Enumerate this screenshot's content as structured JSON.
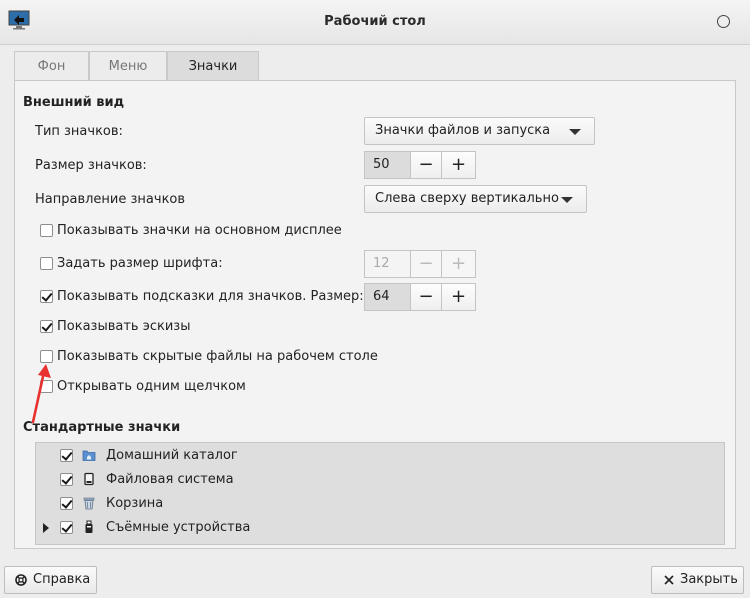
{
  "window": {
    "title": "Рабочий стол"
  },
  "tabs": [
    {
      "label": "Фон"
    },
    {
      "label": "Меню"
    },
    {
      "label": "Значки"
    }
  ],
  "appearance": {
    "title": "Внешний вид",
    "icon_type": {
      "label": "Тип значков:",
      "value": "Значки файлов и запуска"
    },
    "icon_size": {
      "label": "Размер значков:",
      "value": "50",
      "minus": "−",
      "plus": "+"
    },
    "icon_direction": {
      "label": "Направление значков",
      "value": "Слева сверху вертикально"
    },
    "show_on_primary": {
      "label": "Показывать значки на основном дисплее",
      "checked": false
    },
    "font_size": {
      "label": "Задать размер шрифта:",
      "checked": false,
      "value": "12",
      "minus": "−",
      "plus": "+"
    },
    "tooltips": {
      "label": "Показывать подсказки для значков. Размер:",
      "checked": true,
      "value": "64",
      "minus": "−",
      "plus": "+"
    },
    "thumbnails": {
      "label": "Показывать эскизы",
      "checked": true
    },
    "hidden_files": {
      "label": "Показывать скрытые файлы на рабочем столе",
      "checked": false
    },
    "single_click": {
      "label": "Открывать одним щелчком",
      "checked": false
    }
  },
  "standard_icons": {
    "title": "Стандартные значки",
    "items": [
      {
        "label": "Домашний каталог",
        "icon": "home-folder-icon",
        "checked": true
      },
      {
        "label": "Файловая система",
        "icon": "drive-icon",
        "checked": true
      },
      {
        "label": "Корзина",
        "icon": "trash-icon",
        "checked": true
      },
      {
        "label": "Съёмные устройства",
        "icon": "usb-icon",
        "checked": true,
        "expandable": true
      }
    ]
  },
  "footer": {
    "help_label": "Справка",
    "close_label": "Закрыть"
  },
  "colors": {
    "accent_arrow": "#e8312f",
    "folder_blue": "#5a8fd0"
  }
}
